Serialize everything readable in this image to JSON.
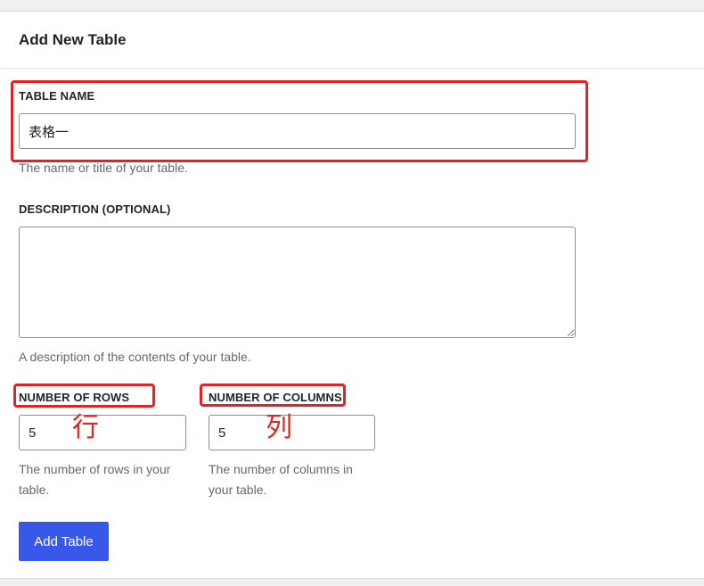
{
  "panel": {
    "title": "Add New Table"
  },
  "form": {
    "table_name": {
      "label": "TABLE NAME",
      "value": "表格一",
      "help": "The name or title of your table."
    },
    "description": {
      "label": "DESCRIPTION (OPTIONAL)",
      "value": "",
      "help": "A description of the contents of your table."
    },
    "rows": {
      "label": "NUMBER OF ROWS",
      "value": "5",
      "help_line1": "The number of rows in your",
      "help_line2": "table."
    },
    "columns": {
      "label": "NUMBER OF COLUMNS",
      "value": "5",
      "help_line1": "The number of columns in",
      "help_line2": "your table."
    },
    "submit_label": "Add Table"
  },
  "annotations": {
    "rows_note": "行",
    "columns_note": "列",
    "color": "#e52222"
  },
  "colors": {
    "button": "#3858e9",
    "help_text": "#646970"
  }
}
